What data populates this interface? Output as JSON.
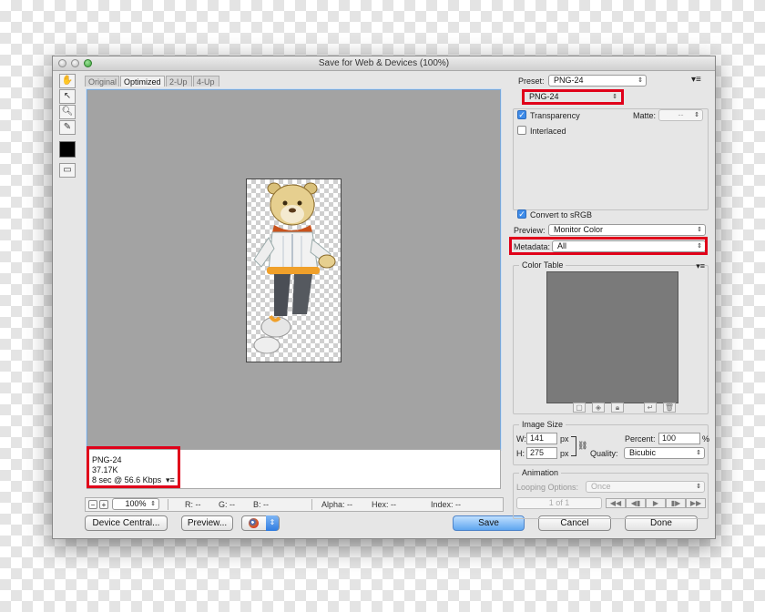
{
  "window": {
    "title": "Save for Web & Devices (100%)"
  },
  "tabs": [
    {
      "label": "Original"
    },
    {
      "label": "Optimized"
    },
    {
      "label": "2-Up"
    },
    {
      "label": "4-Up"
    }
  ],
  "tools": [
    "hand-tool",
    "slice-select-tool",
    "zoom-tool",
    "eyedropper-tool",
    "eyedropper-color-swatch",
    "toggle-slices-visibility"
  ],
  "image_info": {
    "format": "PNG-24",
    "size": "37.17K",
    "time": "8 sec @ 56.6 Kbps"
  },
  "statusbar": {
    "zoom": "100%",
    "r": "R: --",
    "g": "G: --",
    "b": "B: --",
    "alpha": "Alpha: --",
    "hex": "Hex: --",
    "index": "Index: --"
  },
  "buttons": {
    "device_central": "Device Central...",
    "preview": "Preview...",
    "save": "Save",
    "cancel": "Cancel",
    "done": "Done"
  },
  "panel": {
    "preset_label": "Preset:",
    "preset_value": "PNG-24",
    "format_value": "PNG-24",
    "transparency_label": "Transparency",
    "transparency_checked": true,
    "matte_label": "Matte:",
    "matte_value": "--",
    "interlaced_label": "Interlaced",
    "interlaced_checked": false,
    "convert_label": "Convert to sRGB",
    "convert_checked": true,
    "preview_label": "Preview:",
    "preview_value": "Monitor Color",
    "metadata_label": "Metadata:",
    "metadata_value": "All",
    "color_table_label": "Color Table",
    "image_size_label": "Image Size",
    "w_label": "W:",
    "w_value": "141",
    "h_label": "H:",
    "h_value": "275",
    "px_unit": "px",
    "percent_label": "Percent:",
    "percent_value": "100",
    "percent_unit": "%",
    "quality_label": "Quality:",
    "quality_value": "Bicubic",
    "animation_label": "Animation",
    "looping_label": "Looping Options:",
    "looping_value": "Once",
    "frame_counter": "1 of 1"
  },
  "colors": {
    "highlight": "#e0001a",
    "save_button": "#5ea5ef",
    "canvas": "#a3a3a3",
    "color_table": "#7a7a7a"
  }
}
